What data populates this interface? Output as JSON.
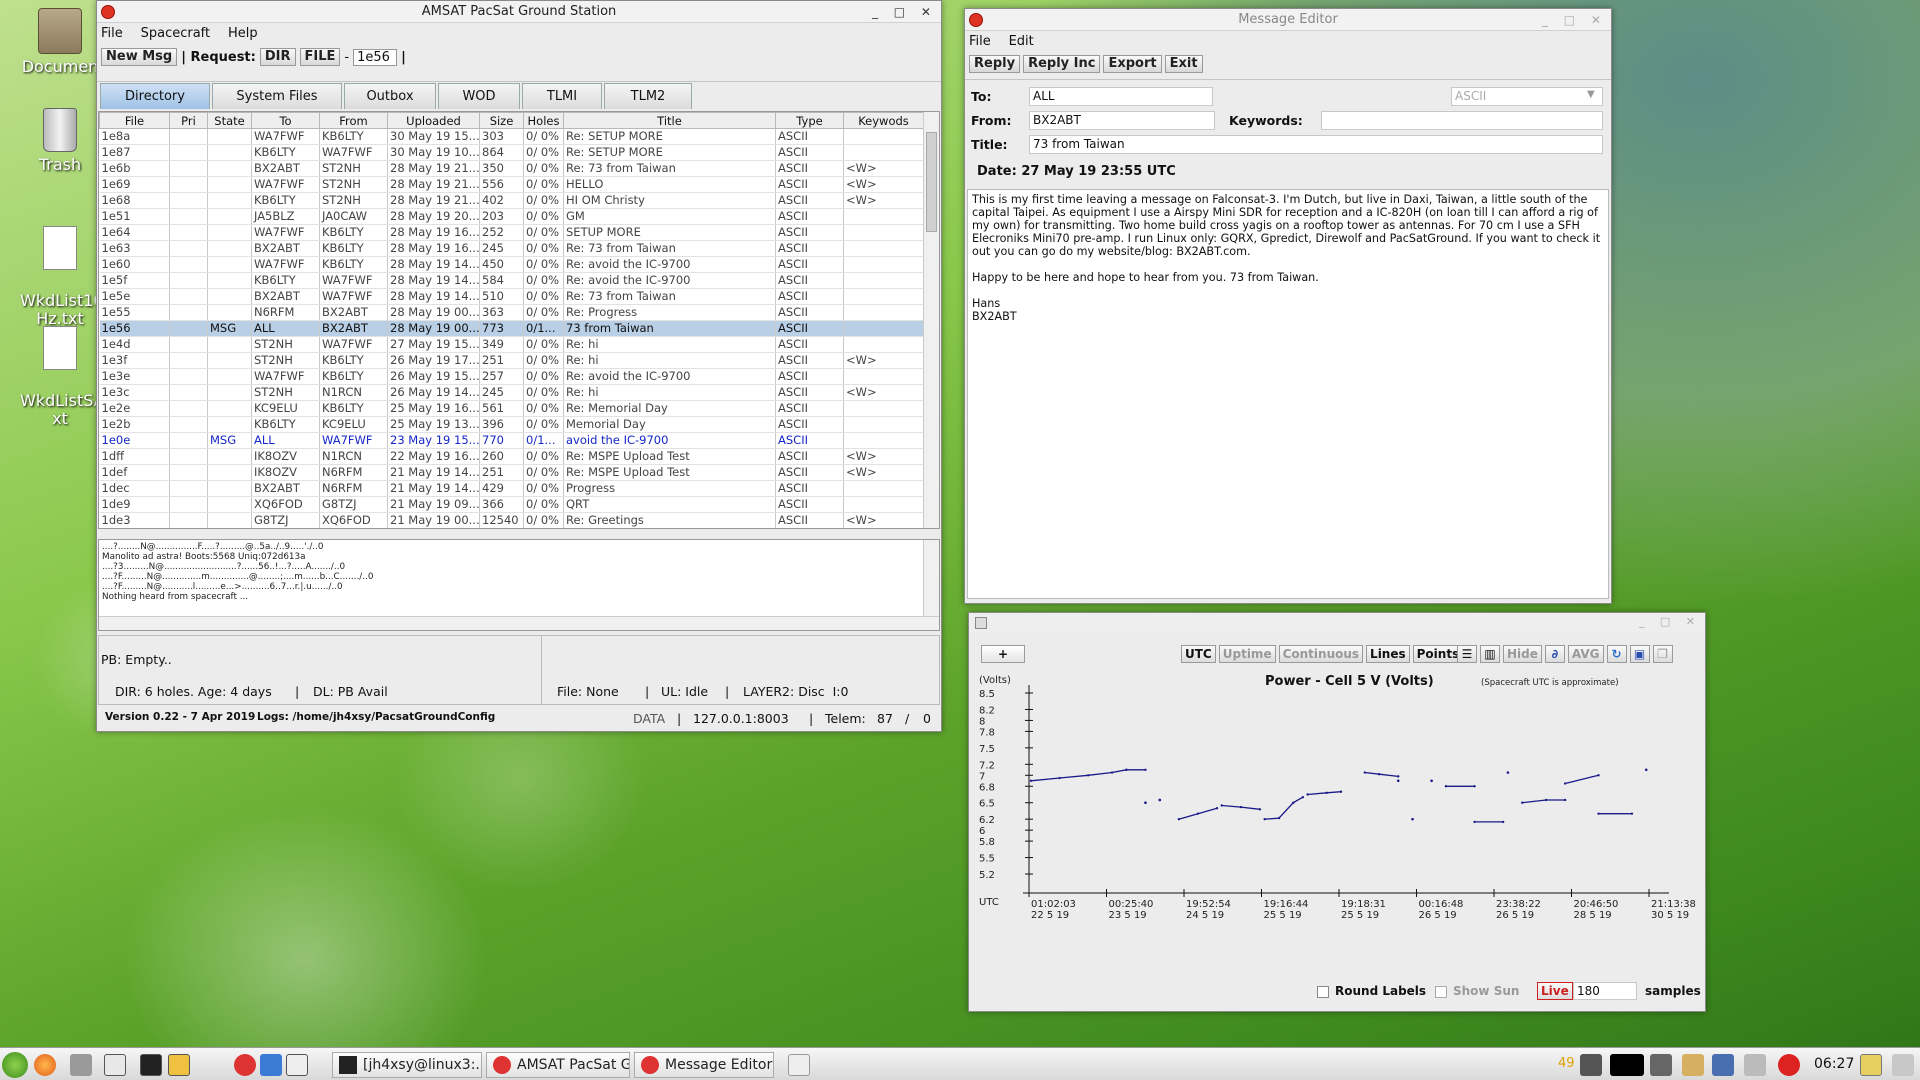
{
  "desktop": {
    "icons": [
      {
        "label": "Documen"
      },
      {
        "label": "Trash"
      },
      {
        "label": "WkdList10\nHz.txt"
      },
      {
        "label": "WkdListSA\nxt"
      }
    ]
  },
  "main": {
    "title": "AMSAT PacSat Ground Station",
    "menu": [
      "File",
      "Spacecraft",
      "Help"
    ],
    "toolbar": {
      "new_msg": "New Msg",
      "request_label": "| Request:",
      "dir": "DIR",
      "file": "FILE",
      "dash": "-",
      "file_id": "1e56",
      "bar": "|"
    },
    "tabs": [
      "Directory",
      "System Files",
      "Outbox",
      "WOD",
      "TLMI",
      "TLM2"
    ],
    "columns": [
      "File",
      "Pri",
      "State",
      "To",
      "From",
      "Uploaded",
      "Size",
      "Holes",
      "Title",
      "Type",
      "Keywods"
    ],
    "rows": [
      [
        "1e8a",
        "",
        "",
        "WA7FWF",
        "KB6LTY",
        "30 May 19 15...",
        "303",
        "0/ 0%",
        "Re: SETUP MORE",
        "ASCII",
        ""
      ],
      [
        "1e87",
        "",
        "",
        "KB6LTY",
        "WA7FWF",
        "30 May 19 10...",
        "864",
        "0/ 0%",
        "Re: SETUP MORE",
        "ASCII",
        ""
      ],
      [
        "1e6b",
        "",
        "",
        "BX2ABT",
        "ST2NH",
        "28 May 19 21...",
        "350",
        "0/ 0%",
        "Re: 73 from Taiwan",
        "ASCII",
        "<W>"
      ],
      [
        "1e69",
        "",
        "",
        "WA7FWF",
        "ST2NH",
        "28 May 19 21...",
        "556",
        "0/ 0%",
        "HELLO",
        "ASCII",
        "<W>"
      ],
      [
        "1e68",
        "",
        "",
        "KB6LTY",
        "ST2NH",
        "28 May 19 21...",
        "402",
        "0/ 0%",
        "HI OM Christy",
        "ASCII",
        "<W>"
      ],
      [
        "1e51",
        "",
        "",
        "JA5BLZ",
        "JA0CAW",
        "28 May 19 20...",
        "203",
        "0/ 0%",
        "GM",
        "ASCII",
        ""
      ],
      [
        "1e64",
        "",
        "",
        "WA7FWF",
        "KB6LTY",
        "28 May 19 16...",
        "252",
        "0/ 0%",
        "SETUP MORE",
        "ASCII",
        ""
      ],
      [
        "1e63",
        "",
        "",
        "BX2ABT",
        "KB6LTY",
        "28 May 19 16...",
        "245",
        "0/ 0%",
        "Re: 73 from Taiwan",
        "ASCII",
        ""
      ],
      [
        "1e60",
        "",
        "",
        "WA7FWF",
        "KB6LTY",
        "28 May 19 14...",
        "450",
        "0/ 0%",
        "Re: avoid the IC-9700",
        "ASCII",
        ""
      ],
      [
        "1e5f",
        "",
        "",
        "KB6LTY",
        "WA7FWF",
        "28 May 19 14...",
        "584",
        "0/ 0%",
        "Re: avoid the IC-9700",
        "ASCII",
        ""
      ],
      [
        "1e5e",
        "",
        "",
        "BX2ABT",
        "WA7FWF",
        "28 May 19 14...",
        "510",
        "0/ 0%",
        "Re: 73 from Taiwan",
        "ASCII",
        ""
      ],
      [
        "1e55",
        "",
        "",
        "N6RFM",
        "BX2ABT",
        "28 May 19 00...",
        "363",
        "0/ 0%",
        "Re: Progress",
        "ASCII",
        ""
      ],
      [
        "1e56",
        "",
        "MSG",
        "ALL",
        "BX2ABT",
        "28 May 19 00...",
        "773",
        "0/1...",
        "73 from Taiwan",
        "ASCII",
        ""
      ],
      [
        "1e4d",
        "",
        "",
        "ST2NH",
        "WA7FWF",
        "27 May 19 15...",
        "349",
        "0/ 0%",
        "Re: hi",
        "ASCII",
        ""
      ],
      [
        "1e3f",
        "",
        "",
        "ST2NH",
        "KB6LTY",
        "26 May 19 17...",
        "251",
        "0/ 0%",
        "Re: hi",
        "ASCII",
        "<W>"
      ],
      [
        "1e3e",
        "",
        "",
        "WA7FWF",
        "KB6LTY",
        "26 May 19 15...",
        "257",
        "0/ 0%",
        "Re: avoid the IC-9700",
        "ASCII",
        ""
      ],
      [
        "1e3c",
        "",
        "",
        "ST2NH",
        "N1RCN",
        "26 May 19 14...",
        "245",
        "0/ 0%",
        "Re: hi",
        "ASCII",
        "<W>"
      ],
      [
        "1e2e",
        "",
        "",
        "KC9ELU",
        "KB6LTY",
        "25 May 19 16...",
        "561",
        "0/ 0%",
        "Re: Memorial Day",
        "ASCII",
        ""
      ],
      [
        "1e2b",
        "",
        "",
        "KB6LTY",
        "KC9ELU",
        "25 May 19 13...",
        "396",
        "0/ 0%",
        "Memorial Day",
        "ASCII",
        ""
      ],
      [
        "1e0e",
        "",
        "MSG",
        "ALL",
        "WA7FWF",
        "23 May 19 15...",
        "770",
        "0/1...",
        "avoid the IC-9700",
        "ASCII",
        ""
      ],
      [
        "1dff",
        "",
        "",
        "IK8OZV",
        "N1RCN",
        "22 May 19 16...",
        "260",
        "0/ 0%",
        "Re: MSPE Upload Test",
        "ASCII",
        "<W>"
      ],
      [
        "1def",
        "",
        "",
        "IK8OZV",
        "N6RFM",
        "21 May 19 14...",
        "251",
        "0/ 0%",
        "Re: MSPE Upload Test",
        "ASCII",
        "<W>"
      ],
      [
        "1dec",
        "",
        "",
        "BX2ABT",
        "N6RFM",
        "21 May 19 14...",
        "429",
        "0/ 0%",
        "Progress",
        "ASCII",
        ""
      ],
      [
        "1de9",
        "",
        "",
        "XQ6FOD",
        "G8TZJ",
        "21 May 19 09...",
        "366",
        "0/ 0%",
        "QRT",
        "ASCII",
        ""
      ],
      [
        "1de3",
        "",
        "",
        "G8TZJ",
        "XQ6FOD",
        "21 May 19 00...",
        "12540",
        "0/ 0%",
        "Re: Greetings",
        "ASCII",
        "<W>"
      ]
    ],
    "selected_index": 12,
    "blue_index": 19,
    "log_lines": [
      "....?........N@...............F.....?.........@..5a../..9.....'./..0",
      "Manolito ad astra! Boots:5568 Uniq:072d613a",
      "....?3.........N@..........................?......56..!...?.....A......./..0",
      "....?F.........N@..............m..............@........;....m......b...C......./..0",
      "....?F.........N@...........l.........e...>..........6..7...r.|.u....../..0",
      "Nothing heard from spacecraft ..."
    ],
    "status": {
      "pb": "PB: Empty..",
      "dir": "DIR: 6 holes. Age: 4 days",
      "sep1": "|",
      "dl": "DL: PB Avail",
      "file": "File: None",
      "sep2": "|",
      "ul": "UL: Idle",
      "sep3": "|",
      "layer2": "LAYER2: Disc  I:0"
    },
    "footer": {
      "version": "Version 0.22 - 7 Apr 2019",
      "logs": "Logs: /home/jh4xsy/PacsatGroundConfig",
      "data": "DATA",
      "sep1": "|",
      "addr": "127.0.0.1:8003",
      "sep2": "|",
      "telem": "Telem:",
      "telem_a": "87",
      "slash": "/",
      "telem_b": "0"
    }
  },
  "editor": {
    "title": "Message Editor",
    "menu": [
      "File",
      "Edit"
    ],
    "buttons": [
      "Reply",
      "Reply Inc",
      "Export",
      "Exit"
    ],
    "to_label": "To:",
    "to": "ALL",
    "encoding": "ASCII",
    "from_label": "From:",
    "from": "BX2ABT",
    "keywords_label": "Keywords:",
    "keywords": "",
    "title_label": "Title:",
    "msg_title": "73 from Taiwan",
    "date": "Date: 27 May 19 23:55 UTC",
    "body": "This is my first time leaving a message on Falconsat-3. I'm Dutch, but live in Daxi, Taiwan, a little south of the capital Taipei. As equipment I use a Airspy Mini SDR for reception and a IC-820H (on loan till I can afford a rig of my own) for transmitting. Two home build cross yagis on a rooftop tower as antennas. For 70 cm I use a SFH Elecroniks Mini70 pre-amp. I run Linux only: GQRX, Gpredict, Direwolf and PacSatGround. If you want to check it out you can go do my website/blog: BX2ABT.com.\n\nHappy to be here and hope to hear from you. 73 from Taiwan.\n\nHans\nBX2ABT"
  },
  "graph": {
    "plus": "+",
    "buttons": [
      {
        "label": "UTC",
        "dim": false
      },
      {
        "label": "Uptime",
        "dim": true
      },
      {
        "label": "Continuous",
        "dim": true
      },
      {
        "label": "Lines",
        "dim": false
      },
      {
        "label": "Points",
        "dim": false
      }
    ],
    "hide": "Hide",
    "avg": "AVG",
    "round_labels": "Round Labels",
    "show_sun": "Show Sun",
    "live": "Live",
    "samples_value": "180",
    "samples": "samples"
  },
  "chart_data": {
    "type": "line",
    "title": "Power - Cell 5 V (Volts)",
    "note": "(Spacecraft UTC is approximate)",
    "ylabel": "(Volts)",
    "xlabel": "UTC",
    "ylim": [
      5.0,
      8.5
    ],
    "yticks": [
      "8.5",
      "8.2",
      "8",
      "7.8",
      "7.5",
      "7.2",
      "7",
      "6.8",
      "6.5",
      "6.2",
      "6",
      "5.8",
      "5.5",
      "5.2"
    ],
    "xticks": [
      {
        "t": "01:02:03",
        "d": "22 5 19"
      },
      {
        "t": "00:25:40",
        "d": "23 5 19"
      },
      {
        "t": "19:52:54",
        "d": "24 5 19"
      },
      {
        "t": "19:16:44",
        "d": "25 5 19"
      },
      {
        "t": "19:18:31",
        "d": "25 5 19"
      },
      {
        "t": "00:16:48",
        "d": "26 5 19"
      },
      {
        "t": "23:38:22",
        "d": "26 5 19"
      },
      {
        "t": "20:46:50",
        "d": "28 5 19"
      },
      {
        "t": "21:13:38",
        "d": "30 5 19"
      }
    ],
    "segments": [
      [
        [
          0,
          6.9
        ],
        [
          6,
          6.95
        ],
        [
          12,
          7.0
        ],
        [
          17,
          7.05
        ],
        [
          20,
          7.1
        ]
      ],
      [
        [
          20,
          7.1
        ],
        [
          24,
          7.1
        ]
      ],
      [
        [
          24,
          6.5
        ]
      ],
      [
        [
          27,
          6.55
        ]
      ],
      [
        [
          31,
          6.2
        ],
        [
          35,
          6.3
        ],
        [
          39,
          6.4
        ]
      ],
      [
        [
          40,
          6.45
        ],
        [
          44,
          6.42
        ],
        [
          48,
          6.38
        ]
      ],
      [
        [
          49,
          6.2
        ],
        [
          52,
          6.22
        ],
        [
          55,
          6.5
        ],
        [
          57,
          6.6
        ]
      ],
      [
        [
          58,
          6.65
        ],
        [
          62,
          6.68
        ],
        [
          65,
          6.7
        ]
      ],
      [
        [
          70,
          7.05
        ],
        [
          73,
          7.02
        ],
        [
          77,
          6.98
        ]
      ],
      [
        [
          77,
          6.9
        ]
      ],
      [
        [
          80,
          6.2
        ]
      ],
      [
        [
          84,
          6.9
        ]
      ],
      [
        [
          87,
          6.8
        ],
        [
          93,
          6.8
        ]
      ],
      [
        [
          93,
          6.15
        ],
        [
          99,
          6.15
        ]
      ],
      [
        [
          100,
          7.05
        ]
      ],
      [
        [
          103,
          6.5
        ],
        [
          108,
          6.55
        ],
        [
          112,
          6.55
        ]
      ],
      [
        [
          112,
          6.85
        ],
        [
          119,
          7.0
        ]
      ],
      [
        [
          119,
          6.3
        ],
        [
          126,
          6.3
        ]
      ],
      [
        [
          129,
          7.1
        ]
      ]
    ]
  },
  "taskbar": {
    "tasks": [
      "[jh4xsy@linux3:...",
      "AMSAT PacSat G...",
      "Message Editor"
    ],
    "clock": "06:27",
    "temp": "49"
  }
}
